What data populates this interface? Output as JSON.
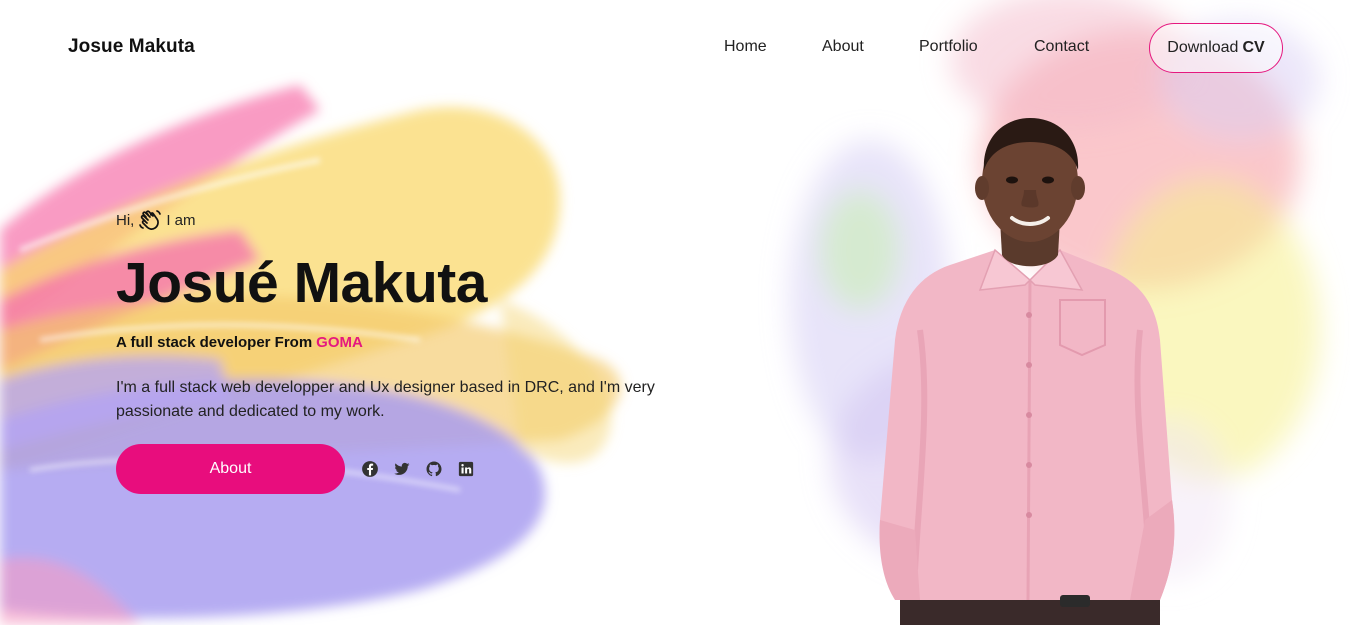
{
  "header": {
    "logo": "Josue Makuta",
    "nav": [
      "Home",
      "About",
      "Portfolio",
      "Contact"
    ],
    "cv_button": {
      "prefix": "Download",
      "bold": "CV"
    }
  },
  "hero": {
    "greeting_before": "Hi,",
    "greeting_after": "I am",
    "greeting_icon": "waving-hand-icon",
    "name": "Josué Makuta",
    "tagline_prefix": "A full stack developer From",
    "tagline_city": "GOMA",
    "description": "I'm a full stack web developper and Ux designer based in DRC, and I'm very passionate and dedicated to my work.",
    "about_button": "About",
    "socials": [
      "facebook-icon",
      "twitter-icon",
      "github-icon",
      "linkedin-icon"
    ]
  },
  "colors": {
    "accent": "#e80d7d",
    "text": "#111111",
    "paint_pink": "#f56aa8",
    "paint_yellow": "#f8dd6b",
    "paint_purple": "#a89cf2"
  }
}
